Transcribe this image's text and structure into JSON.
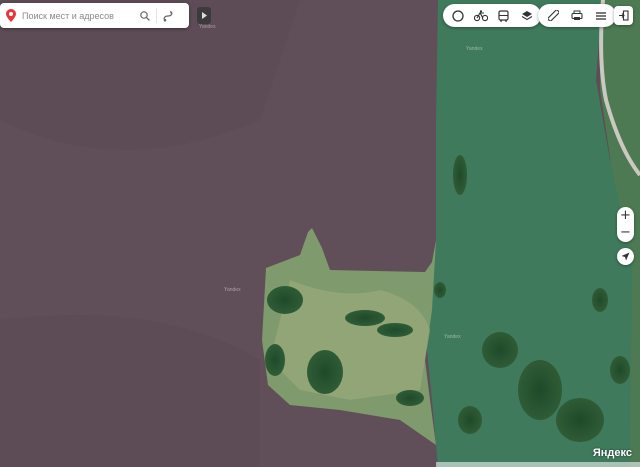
{
  "search": {
    "placeholder": "Поиск мест и адресов"
  },
  "map_labels": {
    "watermark": "Yandex",
    "logo": "Яндекс"
  },
  "controls": {
    "zoom_in": "+",
    "zoom_out": "−",
    "layers": [
      "traffic-icon",
      "bicycle-icon",
      "bus-icon",
      "layers-icon"
    ],
    "tools": [
      "ruler-icon",
      "print-icon",
      "menu-icon"
    ]
  },
  "colors": {
    "search_pin": "#e8373a",
    "field": "#5e4c56",
    "grass": "#3f7a5c"
  }
}
